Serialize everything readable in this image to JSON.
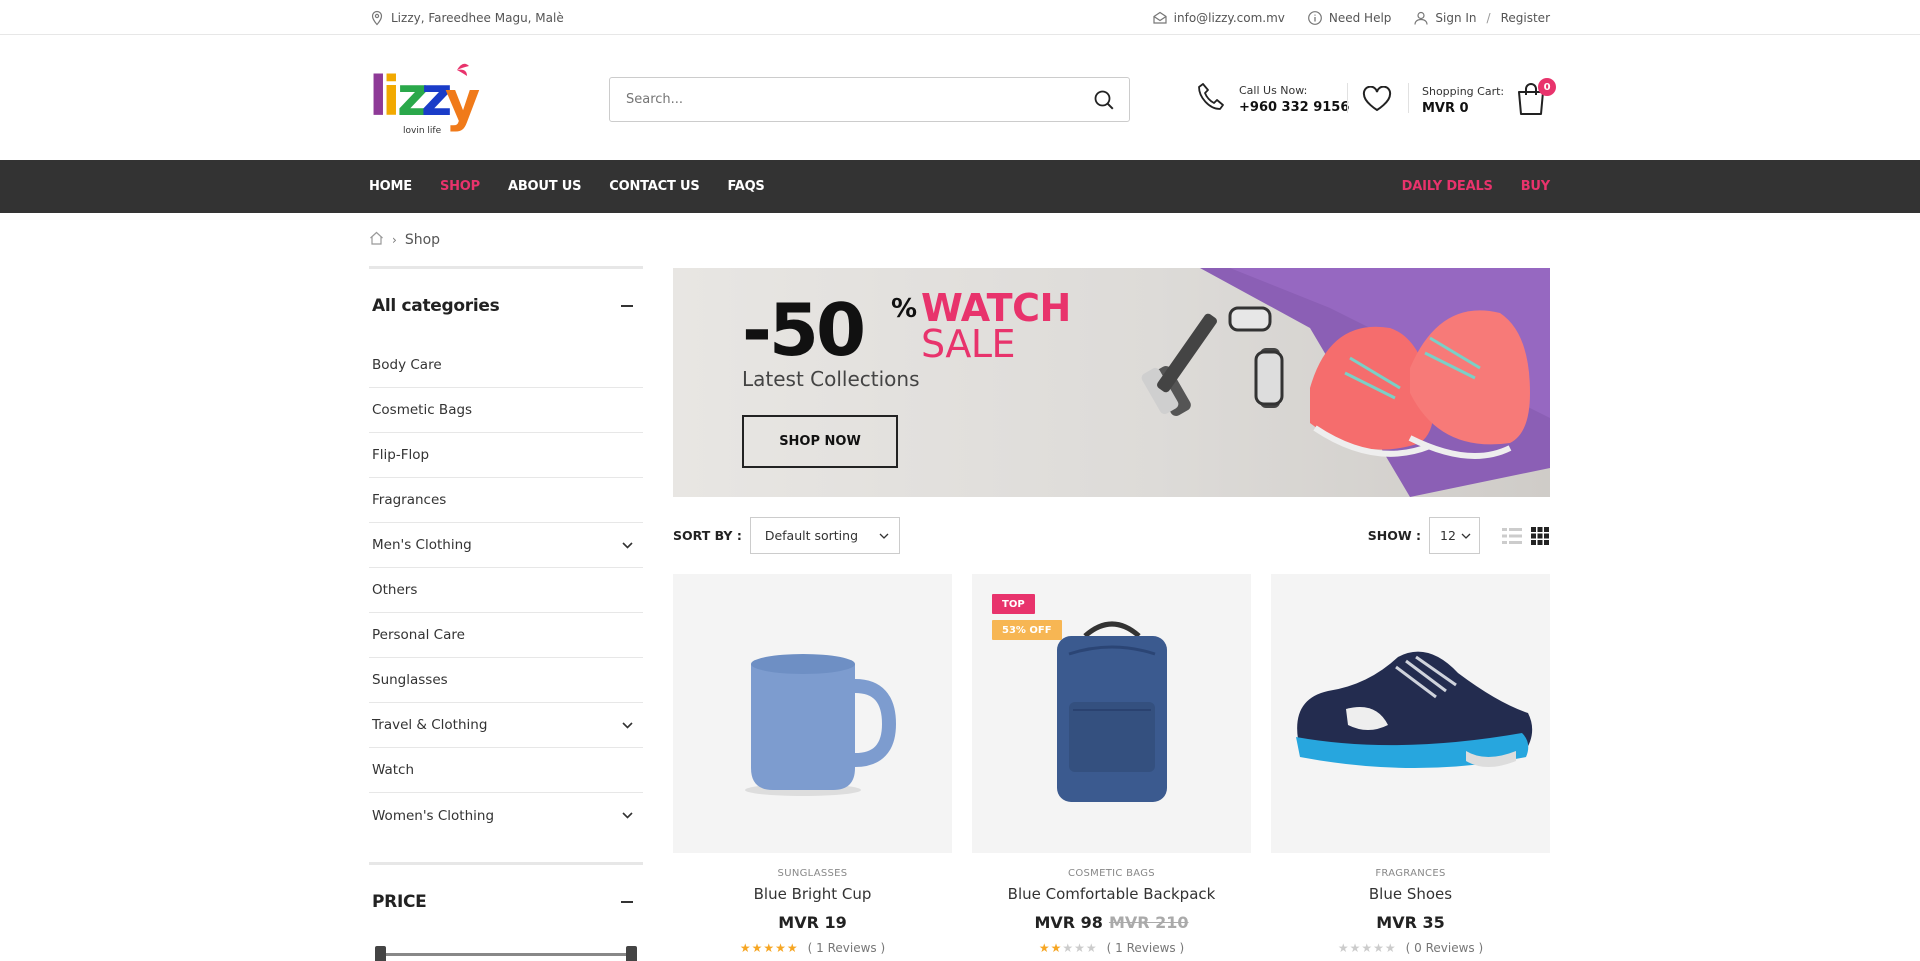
{
  "topbar": {
    "address": "Lizzy, Fareedhee Magu, Malè",
    "email": "info@lizzy.com.mv",
    "help": "Need Help",
    "sign_in": "Sign In",
    "separator": "/",
    "register": "Register"
  },
  "header": {
    "logo_text": "lizzy",
    "logo_tagline": "lovin life",
    "search_placeholder": "Search...",
    "call_label": "Call Us Now:",
    "call_number": "+960 332 9156",
    "cart_label": "Shopping Cart:",
    "cart_total": "MVR 0",
    "cart_count": "0"
  },
  "nav": {
    "left": [
      "HOME",
      "SHOP",
      "ABOUT US",
      "CONTACT US",
      "FAQS"
    ],
    "active": "SHOP",
    "right": [
      "DAILY DEALS",
      "BUY"
    ]
  },
  "breadcrumb": {
    "current": "Shop"
  },
  "sidebar": {
    "categories_title": "All categories",
    "categories": [
      {
        "label": "Body Care",
        "expandable": false
      },
      {
        "label": "Cosmetic Bags",
        "expandable": false
      },
      {
        "label": "Flip-Flop",
        "expandable": false
      },
      {
        "label": "Fragrances",
        "expandable": false
      },
      {
        "label": "Men's Clothing",
        "expandable": true
      },
      {
        "label": "Others",
        "expandable": false
      },
      {
        "label": "Personal Care",
        "expandable": false
      },
      {
        "label": "Sunglasses",
        "expandable": false
      },
      {
        "label": "Travel & Clothing",
        "expandable": true
      },
      {
        "label": "Watch",
        "expandable": false
      },
      {
        "label": "Women's Clothing",
        "expandable": true
      }
    ],
    "price_title": "PRICE"
  },
  "banner": {
    "discount": "-50",
    "percent": "%",
    "line1": "WATCH",
    "line2": "SALE",
    "subtitle": "Latest Collections",
    "button": "SHOP NOW"
  },
  "toolbar": {
    "sort_label": "SORT BY :",
    "sort_value": "Default sorting",
    "show_label": "SHOW :",
    "show_value": "12"
  },
  "products": [
    {
      "category": "SUNGLASSES",
      "name": "Blue Bright Cup",
      "price": "MVR  19",
      "old_price": "",
      "rating": 5,
      "reviews": "( 1 Reviews )",
      "labels": []
    },
    {
      "category": "COSMETIC BAGS",
      "name": "Blue Comfortable Backpack",
      "price": "MVR  98",
      "old_price": "MVR  210",
      "rating": 2,
      "reviews": "( 1 Reviews )",
      "labels": [
        {
          "text": "TOP",
          "color": "#e8336c"
        },
        {
          "text": "53% OFF",
          "color": "#f7b653"
        }
      ]
    },
    {
      "category": "FRAGRANCES",
      "name": "Blue Shoes",
      "price": "MVR  35",
      "old_price": "",
      "rating": 0,
      "reviews": "( 0 Reviews )",
      "labels": []
    }
  ],
  "colors": {
    "accent": "#e8336c",
    "nav_bg": "#333333",
    "star": "#f6a623"
  }
}
